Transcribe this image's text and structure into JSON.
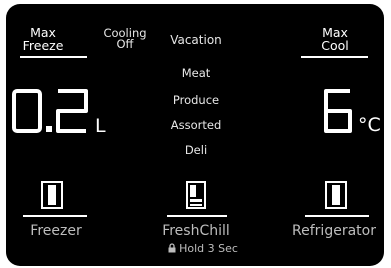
{
  "top": {
    "max_freeze": [
      "Max",
      "Freeze"
    ],
    "cooling_off": [
      "Cooling",
      "Off"
    ],
    "vacation": "Vacation",
    "max_cool": [
      "Max",
      "Cool"
    ]
  },
  "modes": [
    "Meat",
    "Produce",
    "Assorted",
    "Deli"
  ],
  "freezer": {
    "display_value": "0.2",
    "unit": "L",
    "label": "Freezer"
  },
  "refrigerator": {
    "display_value": "6",
    "unit": "°C",
    "label": "Refrigerator"
  },
  "freshchill": {
    "label": "FreshChill",
    "hold_text": "Hold 3 Sec"
  },
  "icons": {
    "freezer": "freezer-door-icon",
    "freshchill": "freshchill-drawer-icon",
    "refrigerator": "refrigerator-door-icon",
    "lock": "lock-icon"
  },
  "colors": {
    "panel": "#000000",
    "text": "#ffffff",
    "label_gray": "#bdbdbd"
  }
}
